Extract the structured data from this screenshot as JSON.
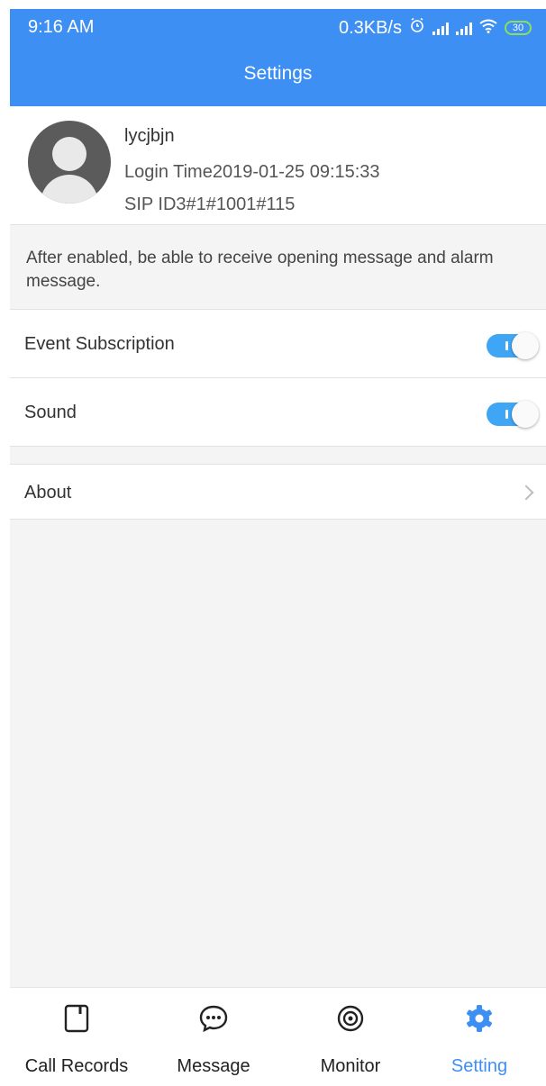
{
  "status": {
    "time": "9:16 AM",
    "speed": "0.3KB/s",
    "battery": "30"
  },
  "header": {
    "title": "Settings"
  },
  "profile": {
    "name": "lycjbjn",
    "login_time": "Login Time2019-01-25 09:15:33",
    "sip_id": "SIP ID3#1#1001#115"
  },
  "note": "After enabled, be able to receive opening message and alarm message.",
  "settings": {
    "event_subscription": {
      "label": "Event Subscription",
      "enabled": true
    },
    "sound": {
      "label": "Sound",
      "enabled": true
    },
    "about": {
      "label": "About"
    }
  },
  "tabs": [
    {
      "label": "Call Records",
      "icon": "call-records-icon",
      "active": false
    },
    {
      "label": "Message",
      "icon": "message-icon",
      "active": false
    },
    {
      "label": "Monitor",
      "icon": "monitor-icon",
      "active": false
    },
    {
      "label": "Setting",
      "icon": "gear-icon",
      "active": true
    }
  ],
  "colors": {
    "header": "#3d8ff3",
    "toggle_on": "#3fa6f5",
    "active_tab": "#3d8ff3"
  }
}
